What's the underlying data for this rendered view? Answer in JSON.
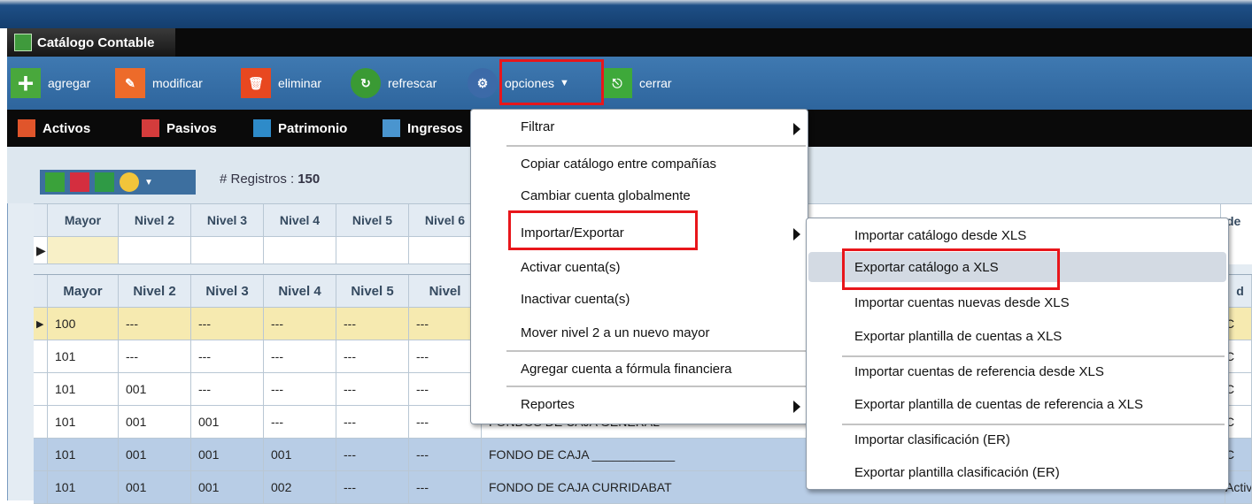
{
  "window": {
    "title": "Catálogo Contable"
  },
  "toolbar": {
    "agregar": "agregar",
    "modificar": "modificar",
    "eliminar": "eliminar",
    "refrescar": "refrescar",
    "opciones": "opciones",
    "cerrar": "cerrar"
  },
  "tabs": [
    "Activos",
    "Pasivos",
    "Patrimonio",
    "Ingresos"
  ],
  "records": {
    "label": "# Registros :",
    "count": "150"
  },
  "filter_headers": [
    "Mayor",
    "Nivel 2",
    "Nivel 3",
    "Nivel 4",
    "Nivel 5",
    "Nivel 6"
  ],
  "grid_headers": [
    "Mayor",
    "Nivel 2",
    "Nivel 3",
    "Nivel 4",
    "Nivel 5",
    "Nivel"
  ],
  "rows": [
    [
      "100",
      "---",
      "---",
      "---",
      "---",
      "---",
      ""
    ],
    [
      "101",
      "---",
      "---",
      "---",
      "---",
      "---",
      ""
    ],
    [
      "101",
      "001",
      "---",
      "---",
      "---",
      "---",
      ""
    ],
    [
      "101",
      "001",
      "001",
      "---",
      "---",
      "---",
      "FONDOS DE CAJA GENERAL"
    ],
    [
      "101",
      "001",
      "001",
      "001",
      "---",
      "---",
      "FONDO DE CAJA ____________"
    ],
    [
      "101",
      "001",
      "001",
      "002",
      "---",
      "---",
      "FONDO DE CAJA CURRIDABAT"
    ]
  ],
  "right_fragments": {
    "header1": "de",
    "header2": "d",
    "col": "C",
    "last": "Activo C"
  },
  "options_menu": [
    "Filtrar",
    "Copiar catálogo entre compañías",
    "Cambiar cuenta globalmente",
    "Importar/Exportar",
    "Activar cuenta(s)",
    "Inactivar cuenta(s)",
    "Mover nivel 2 a un nuevo mayor",
    "Agregar cuenta a fórmula financiera",
    "Reportes"
  ],
  "submenu": [
    "Importar catálogo desde XLS",
    "Exportar catálogo a XLS",
    "Importar cuentas nuevas desde XLS",
    "Exportar plantilla de cuentas a XLS",
    "Importar cuentas de referencia desde XLS",
    "Exportar plantilla de cuentas de referencia a XLS",
    "Importar clasificación (ER)",
    "Exportar plantilla clasificación (ER)"
  ],
  "colors": {
    "highlight_border": "#e8161b",
    "selected_row": "#f6eab0",
    "blue_row": "#b8cde6"
  }
}
